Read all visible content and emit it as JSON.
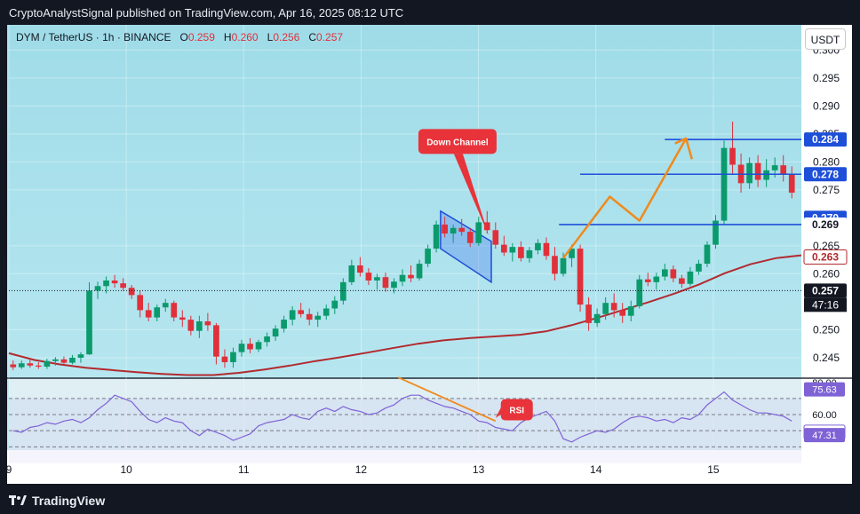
{
  "header": {
    "published_text": "CryptoAnalystSignal published on TradingView.com, Apr 16, 2025 08:12 UTC"
  },
  "legend": {
    "symbol": "DYM / TetherUS · 1h · BINANCE",
    "o_label": "O",
    "o_value": "0.259",
    "h_label": "H",
    "h_value": "0.260",
    "l_label": "L",
    "l_value": "0.256",
    "c_label": "C",
    "c_value": "0.257"
  },
  "currency_button": "USDT",
  "footer": {
    "brand": "TradingView"
  },
  "colors": {
    "background_top": "#9fdce8",
    "background_bottom": "#bde9f2",
    "up_candle": "#0b9a6c",
    "down_candle": "#e0303a",
    "ma_line": "#b22a2f",
    "level_line": "#1e4fd8",
    "arrow": "#f08a1c",
    "rsi_line": "#7e62d6",
    "callout": "#e8333a"
  },
  "chart_data": [
    {
      "type": "candlestick",
      "title": "",
      "x_tick_labels": [
        "9",
        "10",
        "11",
        "12",
        "13",
        "14",
        "15"
      ],
      "y_ticks": [
        0.245,
        0.25,
        0.26,
        0.265,
        0.275,
        0.28,
        0.285,
        0.29,
        0.295,
        0.3
      ],
      "y_tick_labels": [
        "0.245",
        "0.250",
        "0.260",
        "0.265",
        "0.275",
        "0.280",
        "0.285",
        "0.290",
        "0.295",
        "0.300"
      ],
      "ylim": [
        0.2415,
        0.3045
      ],
      "candles": [
        [
          0.2438,
          0.2445,
          0.2428,
          0.2433
        ],
        [
          0.2433,
          0.2445,
          0.243,
          0.244
        ],
        [
          0.244,
          0.2448,
          0.2432,
          0.2436
        ],
        [
          0.2436,
          0.2442,
          0.243,
          0.2434
        ],
        [
          0.2434,
          0.2448,
          0.243,
          0.2444
        ],
        [
          0.2444,
          0.2451,
          0.2436,
          0.2447
        ],
        [
          0.2447,
          0.2452,
          0.2437,
          0.2441
        ],
        [
          0.2441,
          0.2455,
          0.2438,
          0.245
        ],
        [
          0.245,
          0.246,
          0.2441,
          0.2456
        ],
        [
          0.2456,
          0.2585,
          0.2455,
          0.257
        ],
        [
          0.257,
          0.2586,
          0.2555,
          0.2578
        ],
        [
          0.2578,
          0.2595,
          0.2565,
          0.2588
        ],
        [
          0.2588,
          0.2598,
          0.2575,
          0.2583
        ],
        [
          0.2583,
          0.2592,
          0.257,
          0.2575
        ],
        [
          0.2575,
          0.258,
          0.2555,
          0.2562
        ],
        [
          0.2562,
          0.257,
          0.2522,
          0.2535
        ],
        [
          0.2535,
          0.2548,
          0.2515,
          0.2522
        ],
        [
          0.2522,
          0.2545,
          0.2515,
          0.254
        ],
        [
          0.254,
          0.2555,
          0.2532,
          0.2548
        ],
        [
          0.2548,
          0.2552,
          0.2515,
          0.2522
        ],
        [
          0.2522,
          0.2535,
          0.2505,
          0.2518
        ],
        [
          0.2518,
          0.2525,
          0.249,
          0.2498
        ],
        [
          0.2498,
          0.2525,
          0.2485,
          0.2515
        ],
        [
          0.2515,
          0.253,
          0.2498,
          0.2508
        ],
        [
          0.2508,
          0.2512,
          0.2438,
          0.2452
        ],
        [
          0.2452,
          0.2465,
          0.2432,
          0.2442
        ],
        [
          0.2442,
          0.2468,
          0.2432,
          0.246
        ],
        [
          0.246,
          0.2482,
          0.2452,
          0.2475
        ],
        [
          0.2475,
          0.2485,
          0.2458,
          0.2465
        ],
        [
          0.2465,
          0.2482,
          0.246,
          0.2478
        ],
        [
          0.2478,
          0.2495,
          0.247,
          0.2488
        ],
        [
          0.2488,
          0.2508,
          0.248,
          0.2502
        ],
        [
          0.2502,
          0.2525,
          0.2495,
          0.2518
        ],
        [
          0.2518,
          0.2542,
          0.2508,
          0.2535
        ],
        [
          0.2535,
          0.2548,
          0.2522,
          0.2528
        ],
        [
          0.2528,
          0.2538,
          0.2508,
          0.2518
        ],
        [
          0.2518,
          0.2532,
          0.2505,
          0.2525
        ],
        [
          0.2525,
          0.2545,
          0.2518,
          0.2538
        ],
        [
          0.2538,
          0.256,
          0.2528,
          0.2552
        ],
        [
          0.2552,
          0.2592,
          0.2545,
          0.2585
        ],
        [
          0.2585,
          0.2625,
          0.258,
          0.2615
        ],
        [
          0.2615,
          0.263,
          0.2595,
          0.2602
        ],
        [
          0.2602,
          0.261,
          0.258,
          0.2588
        ],
        [
          0.2588,
          0.26,
          0.2572,
          0.2594
        ],
        [
          0.2594,
          0.2602,
          0.2568,
          0.2575
        ],
        [
          0.2575,
          0.2592,
          0.2565,
          0.2586
        ],
        [
          0.2586,
          0.2608,
          0.2578,
          0.2598
        ],
        [
          0.2598,
          0.2615,
          0.2585,
          0.2592
        ],
        [
          0.2592,
          0.2625,
          0.2588,
          0.2618
        ],
        [
          0.2618,
          0.2652,
          0.2612,
          0.2645
        ],
        [
          0.2645,
          0.2695,
          0.2638,
          0.2688
        ],
        [
          0.2688,
          0.2702,
          0.2665,
          0.2672
        ],
        [
          0.2672,
          0.2688,
          0.2655,
          0.2682
        ],
        [
          0.2682,
          0.2698,
          0.2668,
          0.2675
        ],
        [
          0.2675,
          0.2682,
          0.2648,
          0.2655
        ],
        [
          0.2655,
          0.2702,
          0.265,
          0.2692
        ],
        [
          0.2692,
          0.2712,
          0.2672,
          0.2678
        ],
        [
          0.2678,
          0.2692,
          0.2645,
          0.2652
        ],
        [
          0.2652,
          0.2668,
          0.2632,
          0.2638
        ],
        [
          0.2638,
          0.2655,
          0.2622,
          0.2648
        ],
        [
          0.2648,
          0.2658,
          0.2622,
          0.2628
        ],
        [
          0.2628,
          0.2648,
          0.262,
          0.2642
        ],
        [
          0.2642,
          0.2662,
          0.2635,
          0.2655
        ],
        [
          0.2655,
          0.2665,
          0.2625,
          0.2632
        ],
        [
          0.2632,
          0.2648,
          0.2588,
          0.26
        ],
        [
          0.26,
          0.2638,
          0.2595,
          0.2628
        ],
        [
          0.2628,
          0.2652,
          0.2612,
          0.2645
        ],
        [
          0.2645,
          0.2652,
          0.2532,
          0.2545
        ],
        [
          0.2545,
          0.2558,
          0.2498,
          0.2512
        ],
        [
          0.2512,
          0.2538,
          0.2505,
          0.2528
        ],
        [
          0.2528,
          0.2558,
          0.2518,
          0.2548
        ],
        [
          0.2548,
          0.2565,
          0.2522,
          0.2535
        ],
        [
          0.2535,
          0.2548,
          0.2512,
          0.2525
        ],
        [
          0.2525,
          0.2552,
          0.2515,
          0.2542
        ],
        [
          0.2542,
          0.2598,
          0.2538,
          0.259
        ],
        [
          0.259,
          0.2602,
          0.2578,
          0.2585
        ],
        [
          0.2585,
          0.2602,
          0.2572,
          0.2595
        ],
        [
          0.2595,
          0.2618,
          0.2588,
          0.2608
        ],
        [
          0.2608,
          0.2615,
          0.2585,
          0.2592
        ],
        [
          0.2592,
          0.2598,
          0.2575,
          0.2582
        ],
        [
          0.2582,
          0.2612,
          0.2578,
          0.2604
        ],
        [
          0.2604,
          0.2625,
          0.2598,
          0.2618
        ],
        [
          0.2618,
          0.2658,
          0.2612,
          0.2652
        ],
        [
          0.2652,
          0.2705,
          0.2645,
          0.2695
        ],
        [
          0.2695,
          0.2838,
          0.2688,
          0.2825
        ],
        [
          0.2825,
          0.2872,
          0.2778,
          0.2795
        ],
        [
          0.2795,
          0.2815,
          0.2745,
          0.2762
        ],
        [
          0.2762,
          0.2808,
          0.2752,
          0.2798
        ],
        [
          0.2798,
          0.2812,
          0.2755,
          0.2768
        ],
        [
          0.2768,
          0.2805,
          0.2755,
          0.2785
        ],
        [
          0.2785,
          0.2808,
          0.2772,
          0.2794
        ],
        [
          0.2794,
          0.2812,
          0.2765,
          0.2778
        ],
        [
          0.2778,
          0.2792,
          0.2735,
          0.2745
        ]
      ],
      "ma": [
        0.2458,
        0.2446,
        0.2438,
        0.2432,
        0.2428,
        0.2424,
        0.2421,
        0.2419,
        0.2419,
        0.2423,
        0.2429,
        0.2436,
        0.2444,
        0.2451,
        0.2459,
        0.2467,
        0.2475,
        0.2481,
        0.2485,
        0.2488,
        0.2491,
        0.2497,
        0.2508,
        0.2521,
        0.2535,
        0.2549,
        0.2564,
        0.2581,
        0.2601,
        0.2617,
        0.2628,
        0.2633
      ],
      "current_price": 0.257,
      "price_labels": [
        {
          "value": 0.284,
          "text": "0.284",
          "style": "blue"
        },
        {
          "value": 0.2778,
          "text": "0.278",
          "style": "blue"
        },
        {
          "value": 0.27,
          "text": "0.270",
          "style": "blue"
        },
        {
          "value": 0.2688,
          "text": "0.269",
          "style": "white"
        },
        {
          "value": 0.263,
          "text": "0.263",
          "style": "outline"
        },
        {
          "value": 0.257,
          "text": "0.257",
          "style": "dark"
        }
      ],
      "countdown": "47:16",
      "levels": [
        0.284,
        0.2778,
        0.2688
      ],
      "annotations": {
        "channel_label": "Down Channel",
        "rsi_label": "RSI"
      }
    },
    {
      "type": "line",
      "title": "",
      "series": [
        {
          "values": [
            50,
            49,
            52,
            53,
            55,
            54,
            56,
            57,
            55,
            58,
            63,
            67,
            72,
            70,
            68,
            62,
            57,
            55,
            58,
            56,
            55,
            50,
            47,
            51,
            49,
            47,
            44,
            46,
            48,
            53,
            55,
            56,
            57,
            60,
            58,
            57,
            62,
            64,
            62,
            65,
            63,
            62,
            60,
            61,
            64,
            66,
            70,
            72,
            72,
            69,
            67,
            65,
            64,
            62,
            60,
            56,
            55,
            52,
            51,
            50,
            55,
            58,
            60,
            62,
            56,
            45,
            43,
            46,
            48,
            50,
            49,
            51,
            55,
            58,
            59,
            58,
            56,
            57,
            55,
            58,
            57,
            60,
            66,
            70,
            74,
            69,
            66,
            63,
            61,
            61,
            60,
            59,
            56
          ]
        }
      ],
      "y_tick_labels": [
        "80.00",
        "75.63",
        "60.00",
        "49.10",
        "47.31"
      ],
      "ylim": [
        38,
        82
      ],
      "levels": [
        70,
        60,
        50,
        40
      ]
    }
  ]
}
